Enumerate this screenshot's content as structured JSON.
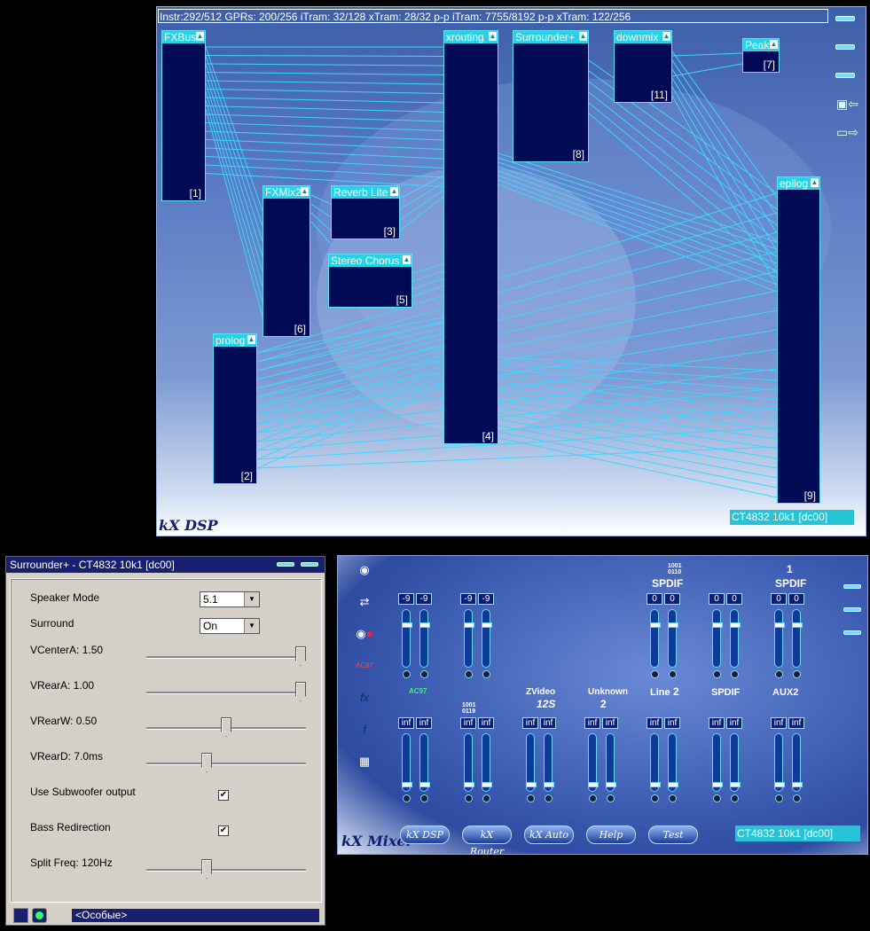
{
  "dsp": {
    "status": "Instr:292/512 GPRs: 200/256 iTram: 32/128 xTram: 28/32 p-p iTram: 7755/8192 p-p xTram: 122/256",
    "logo": "kX DSP",
    "card": "CT4832 10k1 [dc00]",
    "plugins": [
      {
        "name": "FXBus",
        "id": "[1]"
      },
      {
        "name": "prolog",
        "id": "[2]"
      },
      {
        "name": "Reverb Lite",
        "id": "[3]"
      },
      {
        "name": "xrouting",
        "id": "[4]"
      },
      {
        "name": "Stereo Chorus",
        "id": "[5]"
      },
      {
        "name": "FXMix2",
        "id": "[6]"
      },
      {
        "name": "Peak",
        "id": "[7]"
      },
      {
        "name": "Surrounder+",
        "id": "[8]"
      },
      {
        "name": "epilog",
        "id": "[9]"
      },
      {
        "name": "downmix",
        "id": "[11]"
      }
    ],
    "side_icons": [
      "menu-icon",
      "menu-icon",
      "menu-icon",
      "save-icon",
      "open-folder-icon"
    ]
  },
  "surrounder": {
    "title": "Surrounder+ - CT4832 10k1 [dc00]",
    "speaker_mode_label": "Speaker Mode",
    "speaker_mode_value": "5.1",
    "surround_label": "Surround",
    "surround_value": "On",
    "vcenter_label": "VCenterA: 1.50",
    "vcenter_level": 1.0,
    "vreara_label": "VRearA: 1.00",
    "vreara_level": 1.0,
    "vrearw_label": "VRearW: 0.50",
    "vrearw_level": 0.5,
    "vreard_label": "VRearD: 7.0ms",
    "vreard_level": 0.37,
    "subwoofer_label": "Use Subwoofer output",
    "subwoofer_checked": true,
    "bass_label": "Bass Redirection",
    "bass_checked": true,
    "split_label": "Split Freq: 120Hz",
    "split_level": 0.37,
    "preset": "<Особые>"
  },
  "mixer": {
    "logo": "kX Mixer",
    "card": "CT4832 10k1 [dc00]",
    "buttons": [
      "kX DSP",
      "kX Router",
      "kX Auto",
      "Help",
      "Test"
    ],
    "top_row": [
      {
        "values": [
          "-9",
          "-9"
        ]
      },
      {
        "values": [
          "-9",
          "-9"
        ]
      },
      {
        "label": "SPDIF",
        "values": [
          "0",
          "0"
        ]
      },
      {
        "values": [
          "0",
          "0"
        ]
      },
      {
        "label": "SPDIF",
        "values": [
          "0",
          "0"
        ]
      }
    ],
    "top_spdif_code": "1001\n0110",
    "top_spdif_num": "1",
    "bottom_row": [
      {
        "label": "AC97",
        "values": [
          "inf",
          "inf"
        ]
      },
      {
        "label": "1001\n0119",
        "values": [
          "inf",
          "inf"
        ]
      },
      {
        "label": "ZVideo",
        "sub": "12S",
        "values": [
          "inf",
          "inf"
        ]
      },
      {
        "label": "Unknown",
        "sub": "2",
        "values": [
          "inf",
          "inf"
        ]
      },
      {
        "label": "Line",
        "sub": "2",
        "values": [
          "inf",
          "inf"
        ]
      },
      {
        "label": "SPDIF",
        "values": [
          "inf",
          "inf"
        ]
      },
      {
        "label": "AUX2",
        "values": [
          "inf",
          "inf"
        ]
      }
    ],
    "left_icons": [
      "speaker-icon",
      "card-router-icon",
      "record-icon",
      "ac97-icon",
      "fx-icon",
      "function-icon",
      "eq-icon"
    ],
    "ac97_text": "AC97",
    "fx_text": "fx",
    "f_text": "f"
  }
}
